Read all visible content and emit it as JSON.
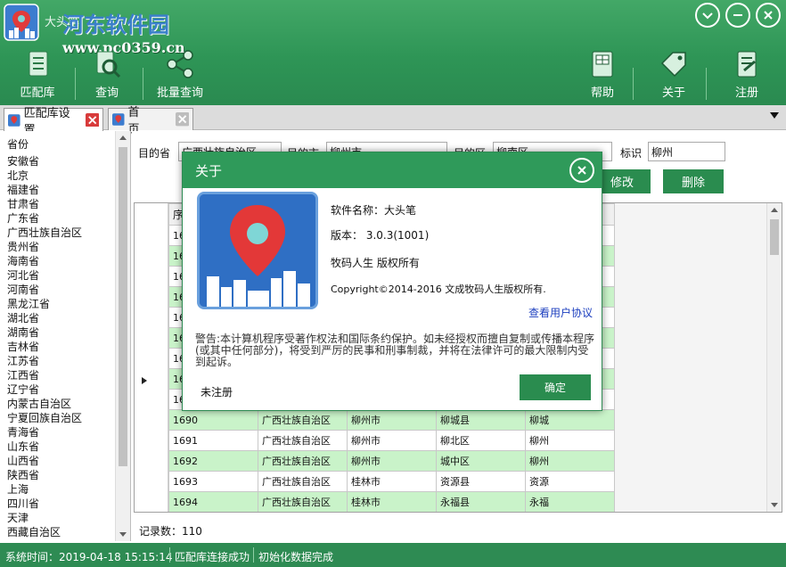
{
  "app": {
    "title": "大头笔",
    "watermark_text": "河东软件园",
    "watermark_url": "www.pc0359.cn"
  },
  "toolbar": {
    "left": [
      {
        "label": "匹配库",
        "icon": "document-list-icon"
      },
      {
        "label": "查询",
        "icon": "search-icon"
      },
      {
        "label": "批量查询",
        "icon": "share-network-icon"
      }
    ],
    "right": [
      {
        "label": "帮助",
        "icon": "book-help-icon"
      },
      {
        "label": "关于",
        "icon": "tag-icon"
      },
      {
        "label": "注册",
        "icon": "register-icon"
      }
    ]
  },
  "tabs": [
    {
      "label": "匹配库设置",
      "active": true
    },
    {
      "label": "首页",
      "active": false
    }
  ],
  "province_panel": {
    "header": "省份",
    "items": [
      "安徽省",
      "北京",
      "福建省",
      "甘肃省",
      "广东省",
      "广西壮族自治区",
      "贵州省",
      "海南省",
      "河北省",
      "河南省",
      "黑龙江省",
      "湖北省",
      "湖南省",
      "吉林省",
      "江苏省",
      "江西省",
      "辽宁省",
      "内蒙古自治区",
      "宁夏回族自治区",
      "青海省",
      "山东省",
      "山西省",
      "陕西省",
      "上海",
      "四川省",
      "天津",
      "西藏自治区"
    ]
  },
  "form": {
    "province_label": "目的省",
    "province_value": "广西壮族自治区",
    "city_label": "目的市",
    "city_value": "柳州市",
    "district_label": "目的区",
    "district_value": "柳南区",
    "tag_label": "标识",
    "tag_value": "柳州",
    "modify_button": "修改",
    "delete_button": "删除"
  },
  "grid": {
    "header_first": "序",
    "rows": [
      [
        "1681",
        "",
        "",
        "",
        ""
      ],
      [
        "1682",
        "",
        "",
        "",
        ""
      ],
      [
        "1683",
        "",
        "",
        "",
        ""
      ],
      [
        "1684",
        "",
        "",
        "",
        ""
      ],
      [
        "1685",
        "",
        "",
        "",
        ""
      ],
      [
        "1686",
        "",
        "",
        "",
        ""
      ],
      [
        "1687",
        "",
        "",
        "",
        ""
      ],
      [
        "1688",
        "",
        "",
        "",
        ""
      ],
      [
        "1689",
        "",
        "",
        "",
        ""
      ],
      [
        "1690",
        "广西壮族自治区",
        "柳州市",
        "柳城县",
        "柳城"
      ],
      [
        "1691",
        "广西壮族自治区",
        "柳州市",
        "柳北区",
        "柳州"
      ],
      [
        "1692",
        "广西壮族自治区",
        "柳州市",
        "城中区",
        "柳州"
      ],
      [
        "1693",
        "广西壮族自治区",
        "桂林市",
        "资源县",
        "资源"
      ],
      [
        "1694",
        "广西壮族自治区",
        "桂林市",
        "永福县",
        "永福"
      ]
    ],
    "visible_id_prefixes": [
      "168",
      "168",
      "168",
      "168",
      "168",
      "168",
      "168",
      "168",
      "168"
    ],
    "record_count_label": "记录数：",
    "record_count": "110"
  },
  "status": {
    "time_label": "系统时间：",
    "time_value": "2019-04-18 15:15:14",
    "db_status": "匹配库连接成功",
    "init_status": "初始化数据完成"
  },
  "about_dialog": {
    "title": "关于",
    "software_name": "软件名称：大头笔",
    "version": "版本： 3.0.3(1001)",
    "owner": "牧码人生  版权所有",
    "copyright": "Copyright©2014-2016 文成牧码人生版权所有.",
    "agreement_link": "查看用户协议",
    "warning": "警告:本计算机程序受著作权法和国际条约保护。如未经授权而擅自复制或传播本程序(或其中任何部分)，将受到严厉的民事和刑事制裁，并将在法律许可的最大限制内受到起诉。",
    "unregistered": "未注册",
    "ok_button": "确定"
  },
  "colors": {
    "toolbar_green": "#2e9556",
    "status_green": "#2e8b53",
    "row_green": "#c9f3c9",
    "button_green": "#2a8c4f",
    "link_blue": "#1c3fbf"
  }
}
